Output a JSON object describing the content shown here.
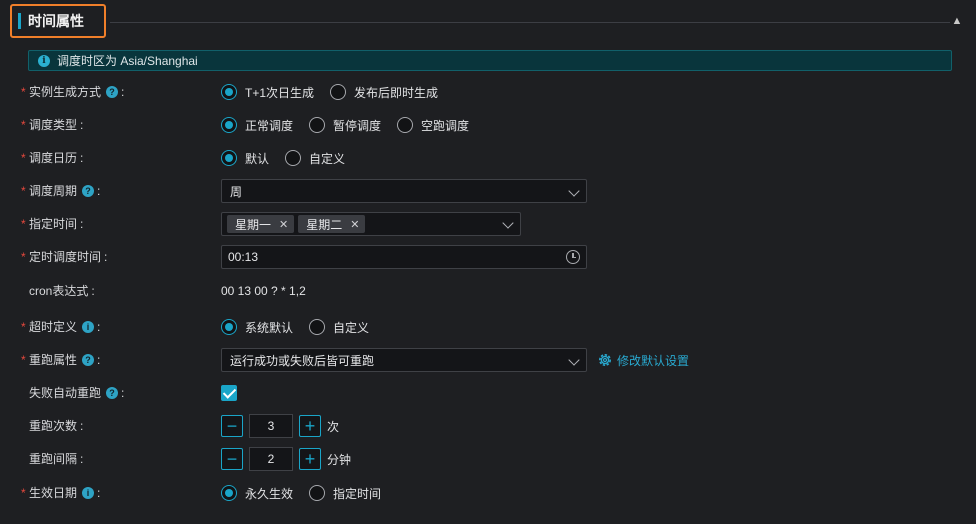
{
  "section": {
    "title": "时间属性"
  },
  "timezone": {
    "text": "调度时区为 Asia/Shanghai"
  },
  "instance_mode": {
    "label": "实例生成方式",
    "options": [
      "T+1次日生成",
      "发布后即时生成"
    ],
    "selected": 0
  },
  "schedule_type": {
    "label": "调度类型",
    "options": [
      "正常调度",
      "暂停调度",
      "空跑调度"
    ],
    "selected": 0
  },
  "schedule_calendar": {
    "label": "调度日历",
    "options": [
      "默认",
      "自定义"
    ],
    "selected": 0
  },
  "schedule_period": {
    "label": "调度周期",
    "value": "周"
  },
  "specified_time": {
    "label": "指定时间",
    "tags": [
      "星期一",
      "星期二"
    ]
  },
  "timed_schedule": {
    "label": "定时调度时间",
    "value": "00:13"
  },
  "cron": {
    "label": "cron表达式",
    "value": "00 13 00 ? * 1,2"
  },
  "timeout": {
    "label": "超时定义",
    "options": [
      "系统默认",
      "自定义"
    ],
    "selected": 0
  },
  "rerun": {
    "label": "重跑属性",
    "value": "运行成功或失败后皆可重跑",
    "link": "修改默认设置"
  },
  "auto_rerun": {
    "label": "失败自动重跑",
    "checked": true
  },
  "rerun_count": {
    "label": "重跑次数",
    "value": "3",
    "unit": "次"
  },
  "rerun_interval": {
    "label": "重跑间隔",
    "value": "2",
    "unit": "分钟"
  },
  "effective_date": {
    "label": "生效日期",
    "options": [
      "永久生效",
      "指定时间"
    ],
    "selected": 0
  },
  "colors": {
    "accent": "#1aa5c8",
    "required": "#e5483d",
    "highlight": "#f07f2a"
  }
}
